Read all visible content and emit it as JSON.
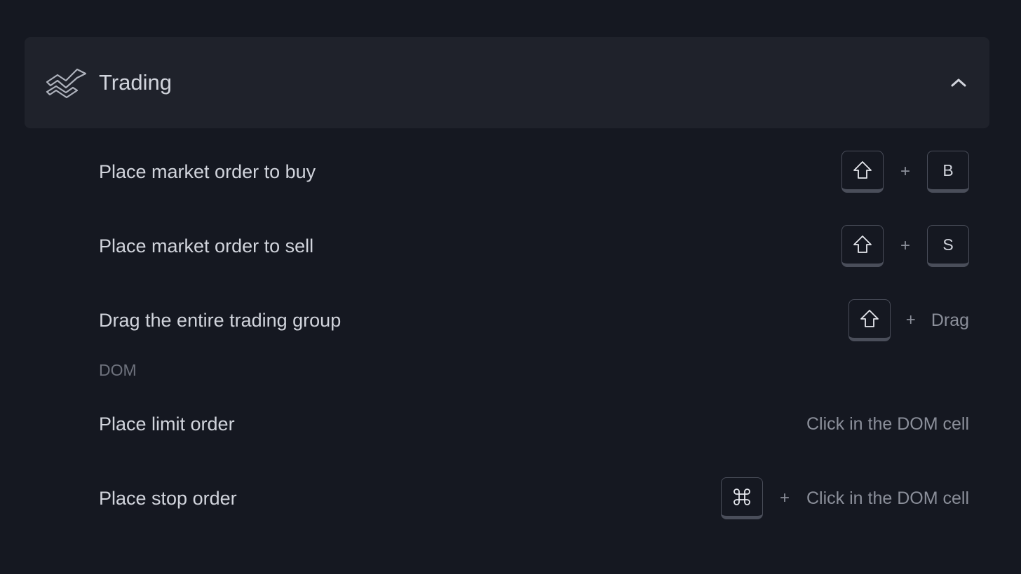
{
  "section": {
    "title": "Trading",
    "icon": "trading-icon",
    "expanded": true,
    "collapse_icon": "chevron-up-icon"
  },
  "shortcuts": [
    {
      "label": "Place market order to buy",
      "keys": [
        "shift-icon",
        "B"
      ],
      "plus": "+"
    },
    {
      "label": "Place market order to sell",
      "keys": [
        "shift-icon",
        "S"
      ],
      "plus": "+"
    },
    {
      "label": "Drag the entire trading group",
      "keys": [
        "shift-icon"
      ],
      "plus": "+",
      "action": "Drag"
    }
  ],
  "dom_group": {
    "title": "DOM",
    "shortcuts": [
      {
        "label": "Place limit order",
        "action": "Click in the DOM cell"
      },
      {
        "label": "Place stop order",
        "keys": [
          "command-icon"
        ],
        "plus": "+",
        "action": "Click in the DOM cell"
      }
    ]
  },
  "colors": {
    "background": "#151821",
    "header_background": "#1f222b",
    "text": "#d1d4dc",
    "muted_text": "#8b8f9a",
    "key_border": "#4a4e5a"
  }
}
